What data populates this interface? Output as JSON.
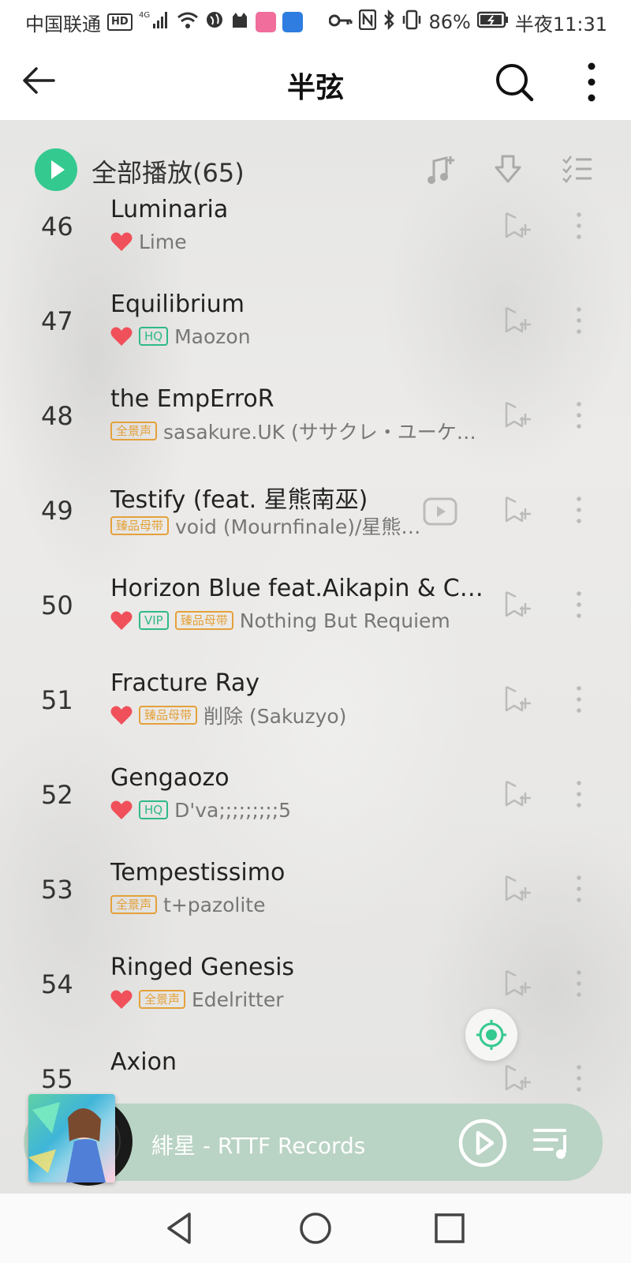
{
  "status_bar": {
    "carrier": "中国联通",
    "hd_badge": "HD",
    "network": "4G",
    "battery_percent": "86%",
    "time": "半夜11:31"
  },
  "header": {
    "title": "半弦"
  },
  "play_all": {
    "label": "全部播放(65)"
  },
  "songs": [
    {
      "index": "46",
      "title": "Luminaria",
      "liked": true,
      "tags": [],
      "artist": "Lime"
    },
    {
      "index": "47",
      "title": "Equilibrium",
      "liked": true,
      "tags": [
        "HQ"
      ],
      "artist": "Maozon"
    },
    {
      "index": "48",
      "title": "the EmpErroR",
      "liked": false,
      "tags": [
        "全景声"
      ],
      "artist": "sasakure.UK (ササクレ・ユーケ…"
    },
    {
      "index": "49",
      "title": "Testify (feat. 星熊南巫)",
      "liked": false,
      "tags": [
        "臻品母带"
      ],
      "artist": "void (Mournfinale)/星熊…",
      "has_video": true
    },
    {
      "index": "50",
      "title": "Horizon Blue feat.Aikapin & Ch…",
      "liked": true,
      "tags": [
        "VIP",
        "臻品母带"
      ],
      "artist": "Nothing But Requiem"
    },
    {
      "index": "51",
      "title": "Fracture Ray",
      "liked": true,
      "tags": [
        "臻品母带"
      ],
      "artist": "削除 (Sakuzyo)"
    },
    {
      "index": "52",
      "title": "Gengaozo",
      "liked": true,
      "tags": [
        "HQ"
      ],
      "artist": "D'va;;;;;;;;;5"
    },
    {
      "index": "53",
      "title": "Tempestissimo",
      "liked": false,
      "tags": [
        "全景声"
      ],
      "artist": "t+pazolite"
    },
    {
      "index": "54",
      "title": "Ringed Genesis",
      "liked": true,
      "tags": [
        "全景声"
      ],
      "artist": "Edelritter"
    },
    {
      "index": "55",
      "title": "Axion",
      "liked": false,
      "tags": [],
      "artist": ""
    }
  ],
  "mini_player": {
    "now_playing": "緋星 - RTTF Records"
  },
  "colors": {
    "accent_green": "#34c98e",
    "heart_red": "#f0505a",
    "tag_gold": "#e4a13a",
    "tag_green": "#2fb98a",
    "mini_player_bg": "#b9d3c4"
  }
}
